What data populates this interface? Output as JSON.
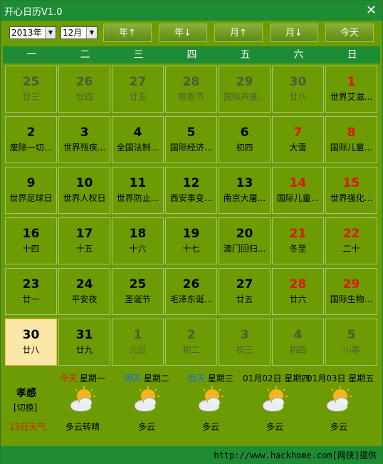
{
  "app": {
    "title": "开心日历V1.0",
    "close_glyph": "✕"
  },
  "toolbar": {
    "year_value": "2013年",
    "month_value": "12月",
    "buttons": [
      "年↑",
      "年↓",
      "月↑",
      "月↓",
      "今天"
    ]
  },
  "weekdays": [
    "一",
    "二",
    "三",
    "四",
    "五",
    "六",
    "日"
  ],
  "calendar": [
    [
      {
        "d": "25",
        "s": "廿三",
        "other": true
      },
      {
        "d": "26",
        "s": "廿四",
        "other": true
      },
      {
        "d": "27",
        "s": "廿五",
        "other": true
      },
      {
        "d": "28",
        "s": "感恩节",
        "other": true
      },
      {
        "d": "29",
        "s": "国际声援...",
        "other": true
      },
      {
        "d": "30",
        "s": "廿八",
        "other": true
      },
      {
        "d": "1",
        "s": "世界艾滋...",
        "hol": true
      }
    ],
    [
      {
        "d": "2",
        "s": "废除一切..."
      },
      {
        "d": "3",
        "s": "世界残疾..."
      },
      {
        "d": "4",
        "s": "全国法制..."
      },
      {
        "d": "5",
        "s": "国际经济..."
      },
      {
        "d": "6",
        "s": "初四"
      },
      {
        "d": "7",
        "s": "大雪",
        "hol": true
      },
      {
        "d": "8",
        "s": "国际儿童...",
        "hol": true
      }
    ],
    [
      {
        "d": "9",
        "s": "世界足球日"
      },
      {
        "d": "10",
        "s": "世界人权日"
      },
      {
        "d": "11",
        "s": "世界防止..."
      },
      {
        "d": "12",
        "s": "西安事变..."
      },
      {
        "d": "13",
        "s": "南京大屠..."
      },
      {
        "d": "14",
        "s": "国际儿童...",
        "hol": true
      },
      {
        "d": "15",
        "s": "世界强化...",
        "hol": true
      }
    ],
    [
      {
        "d": "16",
        "s": "十四"
      },
      {
        "d": "17",
        "s": "十五"
      },
      {
        "d": "18",
        "s": "十六"
      },
      {
        "d": "19",
        "s": "十七"
      },
      {
        "d": "20",
        "s": "澳门回归..."
      },
      {
        "d": "21",
        "s": "冬至",
        "hol": true
      },
      {
        "d": "22",
        "s": "二十",
        "hol": true
      }
    ],
    [
      {
        "d": "23",
        "s": "廿一"
      },
      {
        "d": "24",
        "s": "平安夜"
      },
      {
        "d": "25",
        "s": "圣诞节"
      },
      {
        "d": "26",
        "s": "毛泽东诞..."
      },
      {
        "d": "27",
        "s": "廿五"
      },
      {
        "d": "28",
        "s": "廿六",
        "hol": true
      },
      {
        "d": "29",
        "s": "国际生物...",
        "hol": true
      }
    ],
    [
      {
        "d": "30",
        "s": "廿八",
        "today": true
      },
      {
        "d": "31",
        "s": "廿九"
      },
      {
        "d": "1",
        "s": "元旦",
        "other": true
      },
      {
        "d": "2",
        "s": "初二",
        "other": true
      },
      {
        "d": "3",
        "s": "初三",
        "other": true
      },
      {
        "d": "4",
        "s": "初四",
        "other": true
      },
      {
        "d": "5",
        "s": "小寒",
        "other": true
      }
    ]
  ],
  "weather": {
    "mood": "孝感",
    "switch_label": "[切换]",
    "fifteen_day_label": "15日天气",
    "days": [
      {
        "rel": "今天",
        "rel_color": "#e3140c",
        "label": "星期一",
        "cond": "多云转晴"
      },
      {
        "rel": "明天",
        "rel_color": "#1a6fd6",
        "label": "星期二",
        "cond": "多云"
      },
      {
        "rel": "后天",
        "rel_color": "#1a6fd6",
        "label": "星期三",
        "cond": "多云"
      },
      {
        "rel": "",
        "rel_color": "#000000",
        "label": "01月02日 星期四",
        "cond": "多云"
      },
      {
        "rel": "",
        "rel_color": "#000000",
        "label": "01月03日 星期五",
        "cond": "多云"
      }
    ],
    "icon": "partly-cloudy-icon"
  },
  "footer": {
    "credit": "http://www.hackhome.com[网侠]提供"
  }
}
